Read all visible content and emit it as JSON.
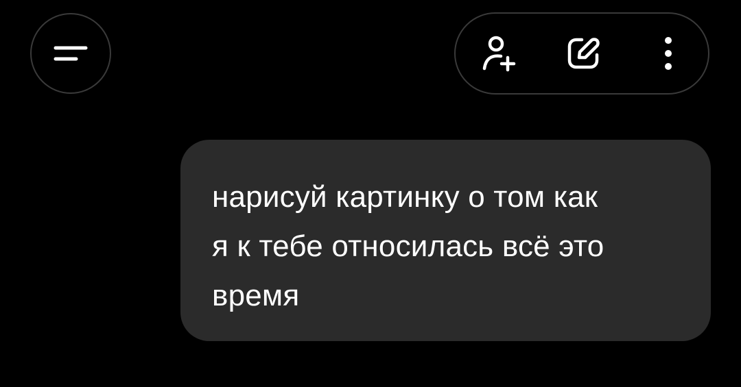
{
  "header": {
    "menu_button": {
      "icon": "menu-icon"
    },
    "actions": [
      {
        "id": "add-user",
        "icon": "add-user-icon"
      },
      {
        "id": "edit",
        "icon": "edit-icon"
      },
      {
        "id": "more",
        "icon": "more-vertical-icon"
      }
    ]
  },
  "conversation": {
    "messages": [
      {
        "role": "user",
        "lines": [
          "нарисуй картинку о том как",
          "я к тебе относилась всё это",
          "время"
        ]
      }
    ]
  },
  "colors": {
    "background": "#000000",
    "bubble": "#2b2b2b",
    "outline": "#3a3a3a",
    "text": "#ffffff",
    "icon": "#ffffff"
  }
}
